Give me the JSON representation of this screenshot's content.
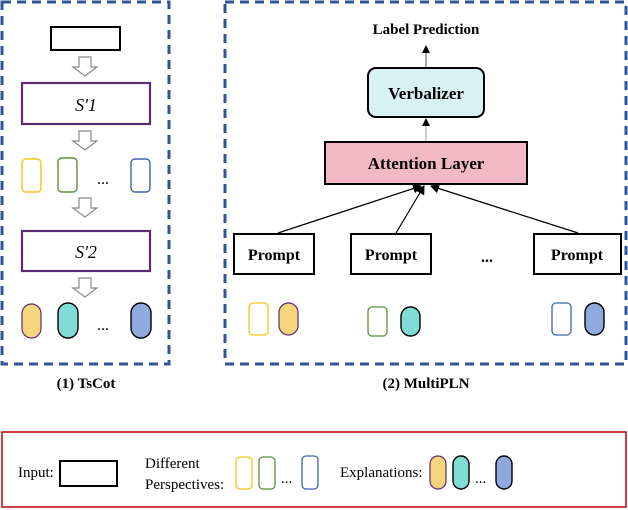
{
  "panel_tscot": {
    "caption": "(1) TsCot",
    "step1_label": "S'1",
    "step2_label": "S'2",
    "ellipsis": "..."
  },
  "panel_multipln": {
    "caption": "(2) MultiPLN",
    "output_label": "Label Prediction",
    "verbalizer_label": "Verbalizer",
    "attention_label": "Attention Layer",
    "prompts": [
      "Prompt",
      "Prompt",
      "Prompt"
    ],
    "ellipsis": "..."
  },
  "legend": {
    "input_label": "Input:",
    "perspectives_label_line1": "Different",
    "perspectives_label_line2": "Perspectives:",
    "explanations_label": "Explanations:",
    "ellipsis": "..."
  },
  "colors": {
    "panel_border": "#2f5597",
    "legend_border": "#c00000",
    "step_border": "#5b2c6f",
    "verbalizer_fill": "#d6f3f1",
    "attention_fill": "#f2b8c3",
    "perspective_yellow": "#f5c518",
    "perspective_green": "#5a8f3c",
    "perspective_blue": "#3b63a8",
    "explanation_yellow": "#f7d57c",
    "explanation_teal": "#7fddd6",
    "explanation_blue": "#8eaadf"
  }
}
